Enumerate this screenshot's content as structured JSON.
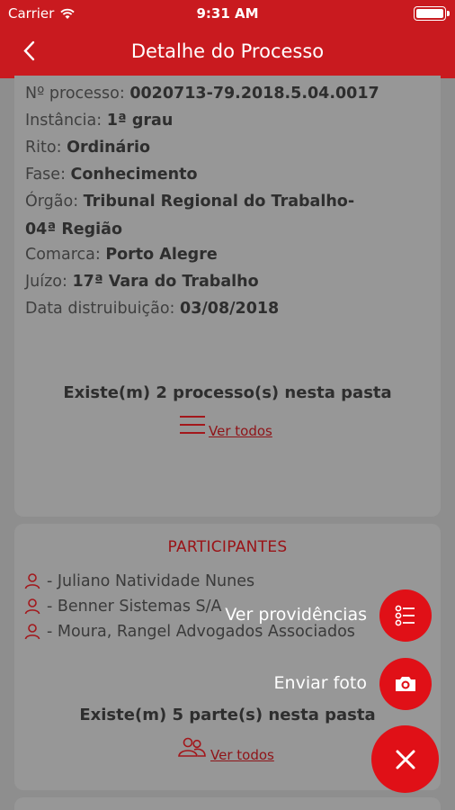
{
  "status_bar": {
    "carrier": "Carrier",
    "time": "9:31 AM"
  },
  "header": {
    "title": "Detalhe do Processo"
  },
  "details": [
    {
      "label": "Nº processo: ",
      "value": "0020713-79.2018.5.04.0017"
    },
    {
      "label": "Instância: ",
      "value": "1ª grau"
    },
    {
      "label": "Rito: ",
      "value": "Ordinário"
    },
    {
      "label": "Fase: ",
      "value": "Conhecimento"
    },
    {
      "label": "Órgão: ",
      "value": "Tribunal Regional do Trabalho-"
    },
    {
      "label": "",
      "value": "04ª Região"
    },
    {
      "label": "Comarca: ",
      "value": "Porto Alegre"
    },
    {
      "label": "Juízo: ",
      "value": "17ª Vara do Trabalho"
    },
    {
      "label": "Data distruibuição: ",
      "value": "03/08/2018"
    }
  ],
  "processes": {
    "summary": "Existe(m) 2 processo(s) nesta pasta",
    "link": "Ver todos"
  },
  "participants": {
    "title": "PARTICIPANTES",
    "items": [
      "- Juliano Natividade Nunes",
      "- Benner Sistemas S/A",
      "- Moura, Rangel Advogados Associados"
    ],
    "summary": "Existe(m) 5 parte(s) nesta pasta",
    "link": "Ver todos"
  },
  "fab_menu": {
    "providencias_label": "Ver providências",
    "foto_label": "Enviar foto"
  },
  "colors": {
    "brand": "#c91a1f",
    "fab": "#e01017"
  }
}
